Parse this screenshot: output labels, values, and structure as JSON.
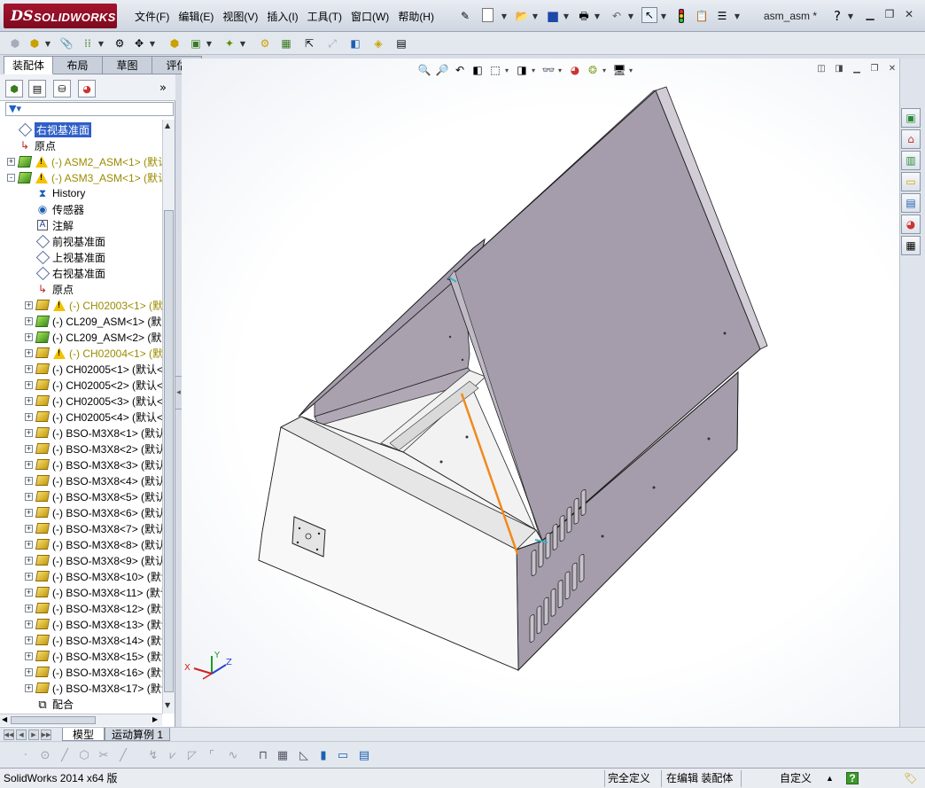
{
  "app": {
    "logo_ds": "DS",
    "logo_text": "SOLIDWORKS",
    "document_title": "asm_asm *"
  },
  "menu": [
    "文件(F)",
    "编辑(E)",
    "视图(V)",
    "插入(I)",
    "工具(T)",
    "窗口(W)",
    "帮助(H)"
  ],
  "tabs": [
    "装配体",
    "布局",
    "草图",
    "评估"
  ],
  "active_tab": "装配体",
  "feature_tree": [
    {
      "indent": 0,
      "exp": "",
      "icon": "plane-icon",
      "label": "右视基准面",
      "style": "sel"
    },
    {
      "indent": 0,
      "exp": "",
      "icon": "origin-icon",
      "label": "原点",
      "style": ""
    },
    {
      "indent": 0,
      "exp": "+",
      "icon": "subassembly-warning-icon",
      "label": "(-) ASM2_ASM<1> (默认",
      "style": "warn"
    },
    {
      "indent": 0,
      "exp": "-",
      "icon": "subassembly-warning-icon",
      "label": "(-) ASM3_ASM<1> (默认",
      "style": "warn"
    },
    {
      "indent": 1,
      "exp": "",
      "icon": "history-icon",
      "label": "History",
      "style": ""
    },
    {
      "indent": 1,
      "exp": "",
      "icon": "sensor-icon",
      "label": "传感器",
      "style": ""
    },
    {
      "indent": 1,
      "exp": "",
      "icon": "annotation-icon",
      "label": "注解",
      "style": ""
    },
    {
      "indent": 1,
      "exp": "",
      "icon": "plane-icon",
      "label": "前视基准面",
      "style": ""
    },
    {
      "indent": 1,
      "exp": "",
      "icon": "plane-icon",
      "label": "上视基准面",
      "style": ""
    },
    {
      "indent": 1,
      "exp": "",
      "icon": "plane-icon",
      "label": "右视基准面",
      "style": ""
    },
    {
      "indent": 1,
      "exp": "",
      "icon": "origin-icon",
      "label": "原点",
      "style": ""
    },
    {
      "indent": 1,
      "exp": "+",
      "icon": "part-warning-icon",
      "label": "(-) CH02003<1> (默认",
      "style": "warn"
    },
    {
      "indent": 1,
      "exp": "+",
      "icon": "subassembly-icon",
      "label": "(-) CL209_ASM<1> (默认",
      "style": ""
    },
    {
      "indent": 1,
      "exp": "+",
      "icon": "subassembly-icon",
      "label": "(-) CL209_ASM<2> (默认",
      "style": ""
    },
    {
      "indent": 1,
      "exp": "+",
      "icon": "part-warning-icon",
      "label": "(-) CH02004<1> (默认",
      "style": "warn"
    },
    {
      "indent": 1,
      "exp": "+",
      "icon": "part-icon",
      "label": "(-) CH02005<1> (默认<",
      "style": ""
    },
    {
      "indent": 1,
      "exp": "+",
      "icon": "part-icon",
      "label": "(-) CH02005<2> (默认<",
      "style": ""
    },
    {
      "indent": 1,
      "exp": "+",
      "icon": "part-icon",
      "label": "(-) CH02005<3> (默认<",
      "style": ""
    },
    {
      "indent": 1,
      "exp": "+",
      "icon": "part-icon",
      "label": "(-) CH02005<4> (默认<",
      "style": ""
    },
    {
      "indent": 1,
      "exp": "+",
      "icon": "part-icon",
      "label": "(-) BSO-M3X8<1> (默认",
      "style": ""
    },
    {
      "indent": 1,
      "exp": "+",
      "icon": "part-icon",
      "label": "(-) BSO-M3X8<2> (默认",
      "style": ""
    },
    {
      "indent": 1,
      "exp": "+",
      "icon": "part-icon",
      "label": "(-) BSO-M3X8<3> (默认",
      "style": ""
    },
    {
      "indent": 1,
      "exp": "+",
      "icon": "part-icon",
      "label": "(-) BSO-M3X8<4> (默认",
      "style": ""
    },
    {
      "indent": 1,
      "exp": "+",
      "icon": "part-icon",
      "label": "(-) BSO-M3X8<5> (默认",
      "style": ""
    },
    {
      "indent": 1,
      "exp": "+",
      "icon": "part-icon",
      "label": "(-) BSO-M3X8<6> (默认",
      "style": ""
    },
    {
      "indent": 1,
      "exp": "+",
      "icon": "part-icon",
      "label": "(-) BSO-M3X8<7> (默认",
      "style": ""
    },
    {
      "indent": 1,
      "exp": "+",
      "icon": "part-icon",
      "label": "(-) BSO-M3X8<8> (默认",
      "style": ""
    },
    {
      "indent": 1,
      "exp": "+",
      "icon": "part-icon",
      "label": "(-) BSO-M3X8<9> (默认",
      "style": ""
    },
    {
      "indent": 1,
      "exp": "+",
      "icon": "part-icon",
      "label": "(-) BSO-M3X8<10> (默认",
      "style": ""
    },
    {
      "indent": 1,
      "exp": "+",
      "icon": "part-icon",
      "label": "(-) BSO-M3X8<11> (默认",
      "style": ""
    },
    {
      "indent": 1,
      "exp": "+",
      "icon": "part-icon",
      "label": "(-) BSO-M3X8<12> (默认",
      "style": ""
    },
    {
      "indent": 1,
      "exp": "+",
      "icon": "part-icon",
      "label": "(-) BSO-M3X8<13> (默认",
      "style": ""
    },
    {
      "indent": 1,
      "exp": "+",
      "icon": "part-icon",
      "label": "(-) BSO-M3X8<14> (默认",
      "style": ""
    },
    {
      "indent": 1,
      "exp": "+",
      "icon": "part-icon",
      "label": "(-) BSO-M3X8<15> (默认",
      "style": ""
    },
    {
      "indent": 1,
      "exp": "+",
      "icon": "part-icon",
      "label": "(-) BSO-M3X8<16> (默认",
      "style": ""
    },
    {
      "indent": 1,
      "exp": "+",
      "icon": "part-icon",
      "label": "(-) BSO-M3X8<17> (默认",
      "style": ""
    },
    {
      "indent": 1,
      "exp": "",
      "icon": "mates-icon",
      "label": "配合",
      "style": ""
    }
  ],
  "bottom_tabs": [
    "模型",
    "运动算例 1"
  ],
  "active_bottom_tab": "模型",
  "triad": {
    "x": "X",
    "y": "Y",
    "z": "Z"
  },
  "colors": {
    "accent_selection": "#2f5fc7",
    "warning_text": "#9a8c00",
    "highlight_edge": "#f08a1c",
    "enclosure_face": "#a59dab"
  },
  "status": {
    "app_version": "SolidWorks 2014 x64 版",
    "definition": "完全定义",
    "editing": "在编辑 装配体",
    "units": "自定义",
    "help": "?"
  }
}
